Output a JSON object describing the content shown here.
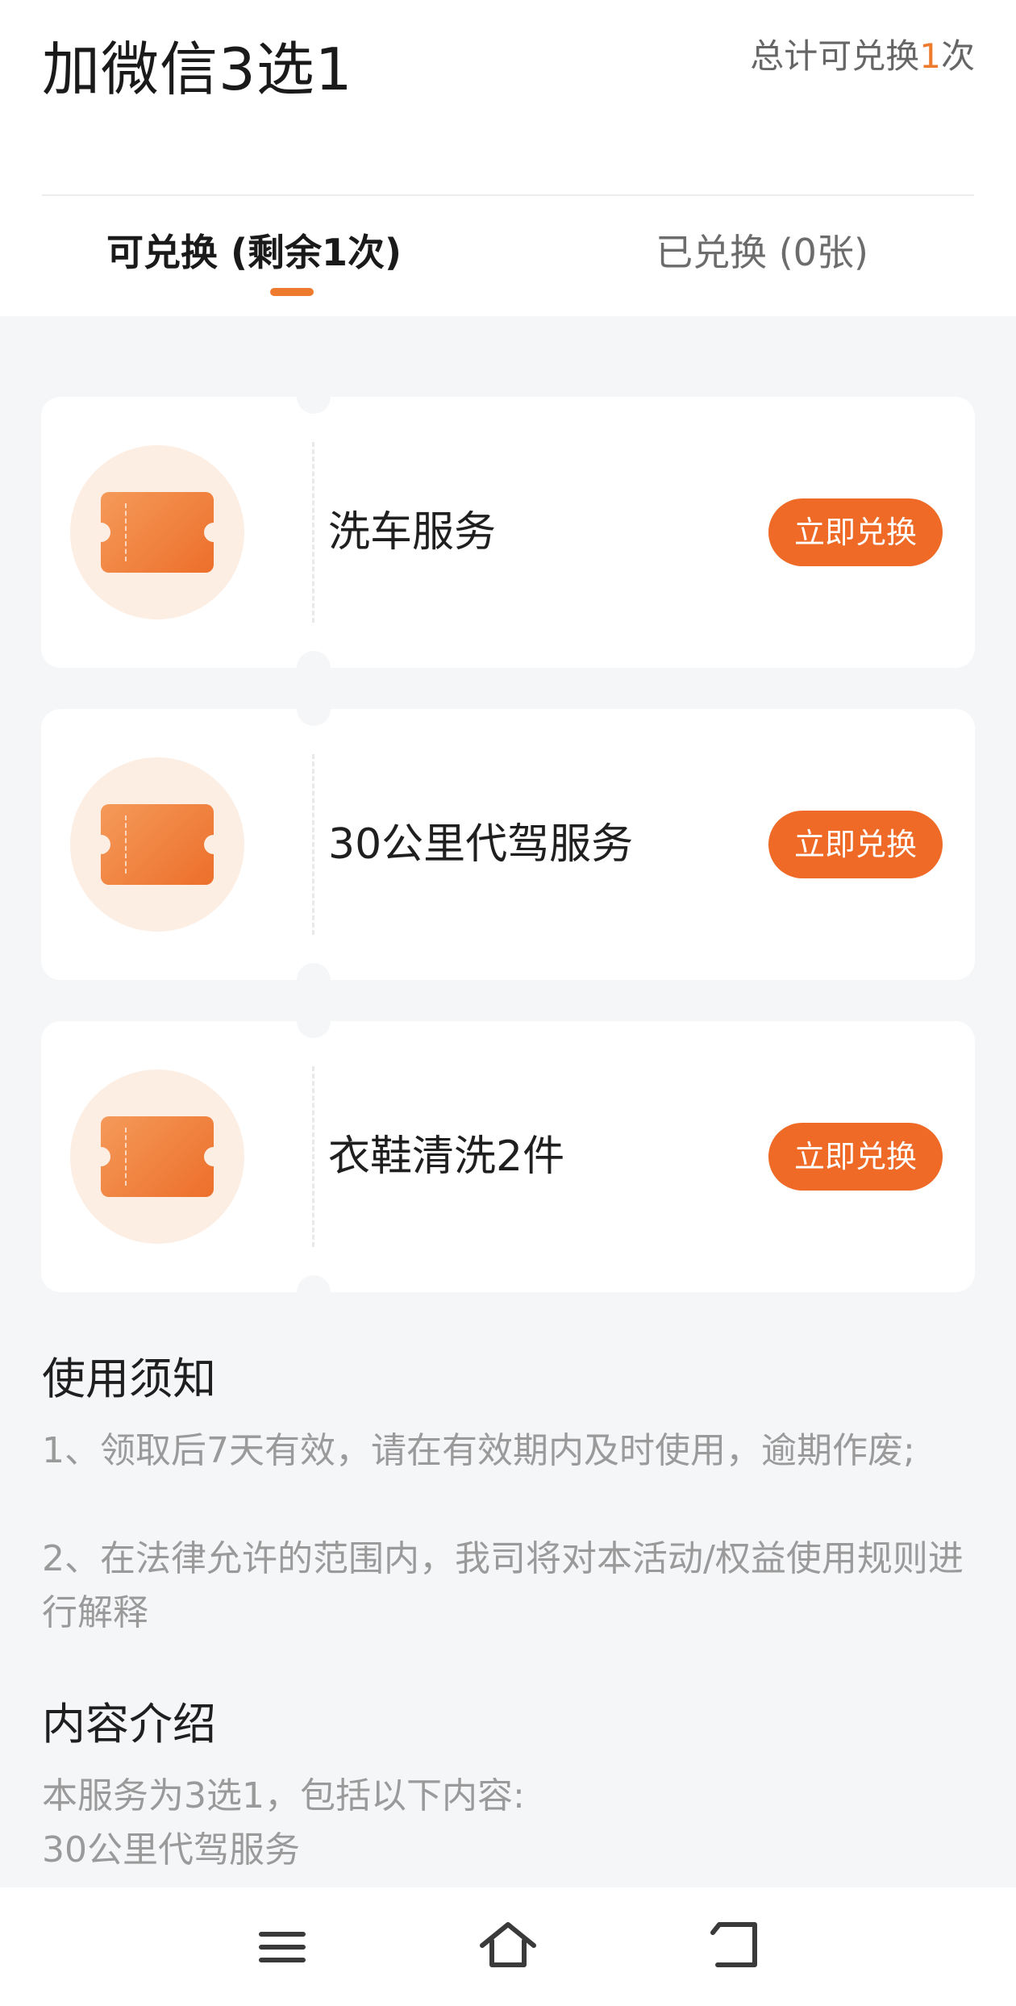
{
  "header": {
    "title": "加微信3选1",
    "total_prefix": "总计可兑换",
    "total_count": "1",
    "total_suffix": "次"
  },
  "tabs": [
    {
      "label": "可兑换 (剩余1次)",
      "active": true
    },
    {
      "label": "已兑换 (0张)",
      "active": false
    }
  ],
  "vouchers": [
    {
      "name": "洗车服务",
      "button": "立即兑换",
      "icon": "ticket-icon"
    },
    {
      "name": "30公里代驾服务",
      "button": "立即兑换",
      "icon": "ticket-icon"
    },
    {
      "name": "衣鞋清洗2件",
      "button": "立即兑换",
      "icon": "ticket-icon"
    }
  ],
  "usage_notes": {
    "title": "使用须知",
    "lines": [
      "1、领取后7天有效，请在有效期内及时使用，逾期作废;",
      "2、在法律允许的范围内，我司将对本活动/权益使用规则进行解释"
    ]
  },
  "content_intro": {
    "title": "内容介绍",
    "lines": [
      "本服务为3选1，包括以下内容:",
      "30公里代驾服务"
    ]
  },
  "nav_bar": {
    "icons": [
      "menu-icon",
      "home-icon",
      "back-icon"
    ]
  },
  "colors": {
    "accent": "#ee6a26",
    "background": "#f5f6f8",
    "icon_bg": "#fdeee4"
  }
}
